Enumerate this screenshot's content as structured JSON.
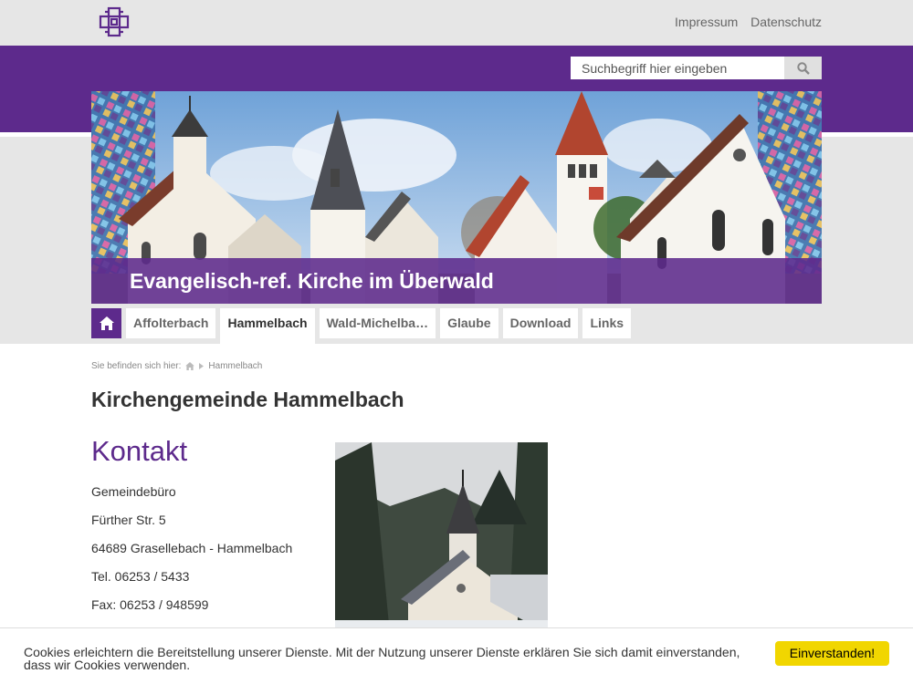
{
  "header": {
    "logo_icon": "cross-logo-icon",
    "links": [
      "Impressum",
      "Datenschutz"
    ]
  },
  "search": {
    "placeholder": "Suchbegriff hier eingeben",
    "icon": "search-icon"
  },
  "banner": {
    "title": "Evangelisch-ref. Kirche im Überwald"
  },
  "nav": {
    "home_icon": "home-icon",
    "tabs": [
      "Affolterbach",
      "Hammelbach",
      "Wald-Michelba…",
      "Glaube",
      "Download",
      "Links"
    ],
    "active": "Hammelbach"
  },
  "breadcrumb": {
    "prefix": "Sie befinden sich hier:",
    "current": "Hammelbach"
  },
  "page": {
    "title": "Kirchengemeinde Hammelbach",
    "kontakt": {
      "heading": "Kontakt",
      "lines": [
        "Gemeindebüro",
        "Fürther Str. 5",
        "64689 Grasellebach - Hammelbach",
        "Tel. 06253 / 5433",
        "Fax: 06253 / 948599"
      ]
    }
  },
  "cookie": {
    "text": "Cookies erleichtern die Bereitstellung unserer Dienste. Mit der Nutzung unserer Dienste erklären Sie sich damit einverstanden, dass wir Cookies verwenden.",
    "button": "Einverstanden!"
  },
  "colors": {
    "brand_purple": "#5d2a8c",
    "light_gray": "#e6e6e6",
    "cookie_button": "#f1d600"
  }
}
